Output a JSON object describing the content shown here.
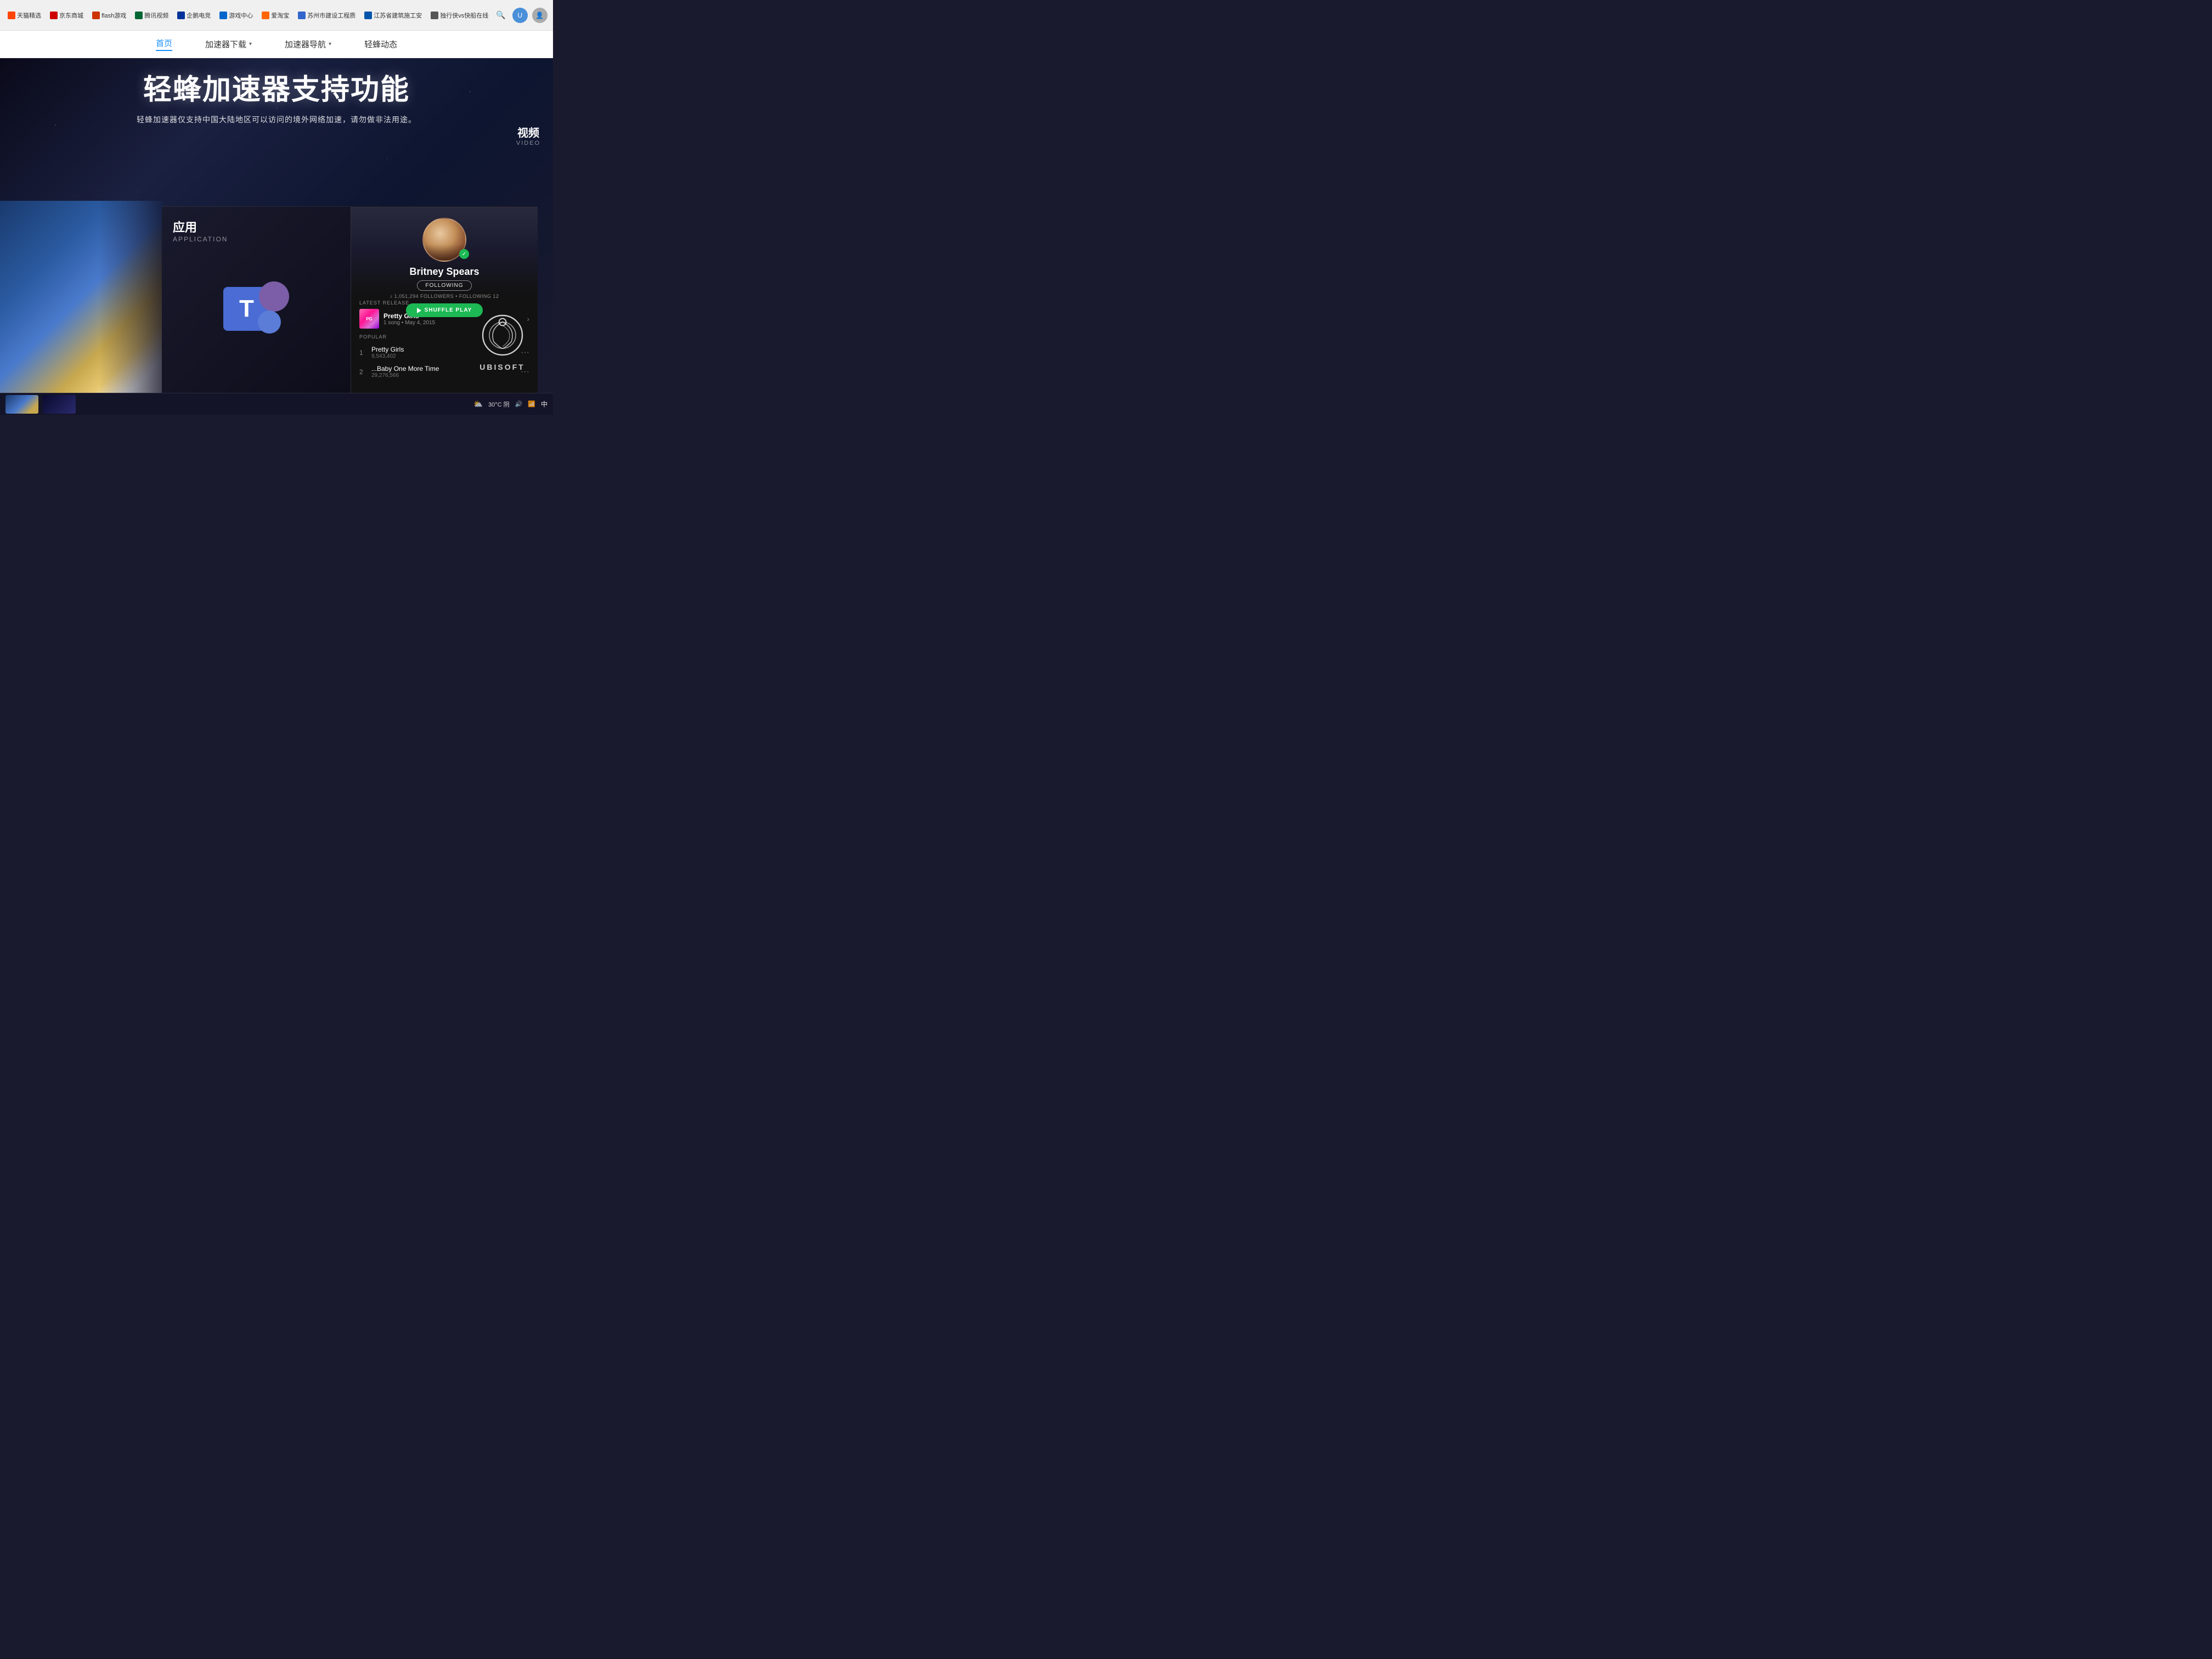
{
  "browser": {
    "bookmarks": [
      {
        "label": "天猫精选",
        "iconClass": "icon-tmall"
      },
      {
        "label": "京东商城",
        "iconClass": "icon-jd"
      },
      {
        "label": "flash游戏",
        "iconClass": "icon-flash"
      },
      {
        "label": "腾讯视频",
        "iconClass": "icon-tencent"
      },
      {
        "label": "企鹅电竞",
        "iconClass": "icon-qipeng"
      },
      {
        "label": "游戏中心",
        "iconClass": "icon-game"
      },
      {
        "label": "爱淘宝",
        "iconClass": "icon-taobao"
      },
      {
        "label": "苏州市建设工程质",
        "iconClass": "icon-suzhou"
      },
      {
        "label": "江苏省建筑施工安",
        "iconClass": "icon-jiangsu"
      },
      {
        "label": "独行侠vs快船在线",
        "iconClass": "icon-solo"
      }
    ]
  },
  "nav": {
    "items": [
      {
        "label": "首页",
        "active": true
      },
      {
        "label": "加速器下载",
        "hasChevron": true
      },
      {
        "label": "加速器导航",
        "hasChevron": true
      },
      {
        "label": "轻蜂动态"
      }
    ]
  },
  "hero": {
    "title": "轻蜂加速器支持功能",
    "subtitle": "轻蜂加速器仅支持中国大陆地区可以访问的境外网络加速，请勿做非法用途。"
  },
  "app_section": {
    "title_cn": "应用",
    "title_en": "APPLICATION"
  },
  "spotify": {
    "artist_name": "Britney Spears",
    "following_label": "FOLLOWING",
    "followers": "1,051,294",
    "followers_label": "FOLLOWERS",
    "following_count": "12",
    "following_count_label": "FOLLOWING",
    "shuffle_play": "SHUFFLE PLAY",
    "latest_release_label": "LATEST RELEASE",
    "release_name": "Pretty Girls",
    "release_meta": "1 song • May 4, 2015",
    "popular_label": "POPULAR",
    "tracks": [
      {
        "num": "1",
        "name": "Pretty Girls",
        "plays": "9,543,402"
      },
      {
        "num": "2",
        "name": "...Baby One More Time",
        "plays": "29,276,566"
      }
    ]
  },
  "video_section": {
    "title_cn": "视频",
    "title_en": "VIDEO"
  },
  "ubisoft": {
    "label": "UBISOFT"
  },
  "taskbar": {
    "weather": "30°C 阴",
    "time": "中"
  }
}
